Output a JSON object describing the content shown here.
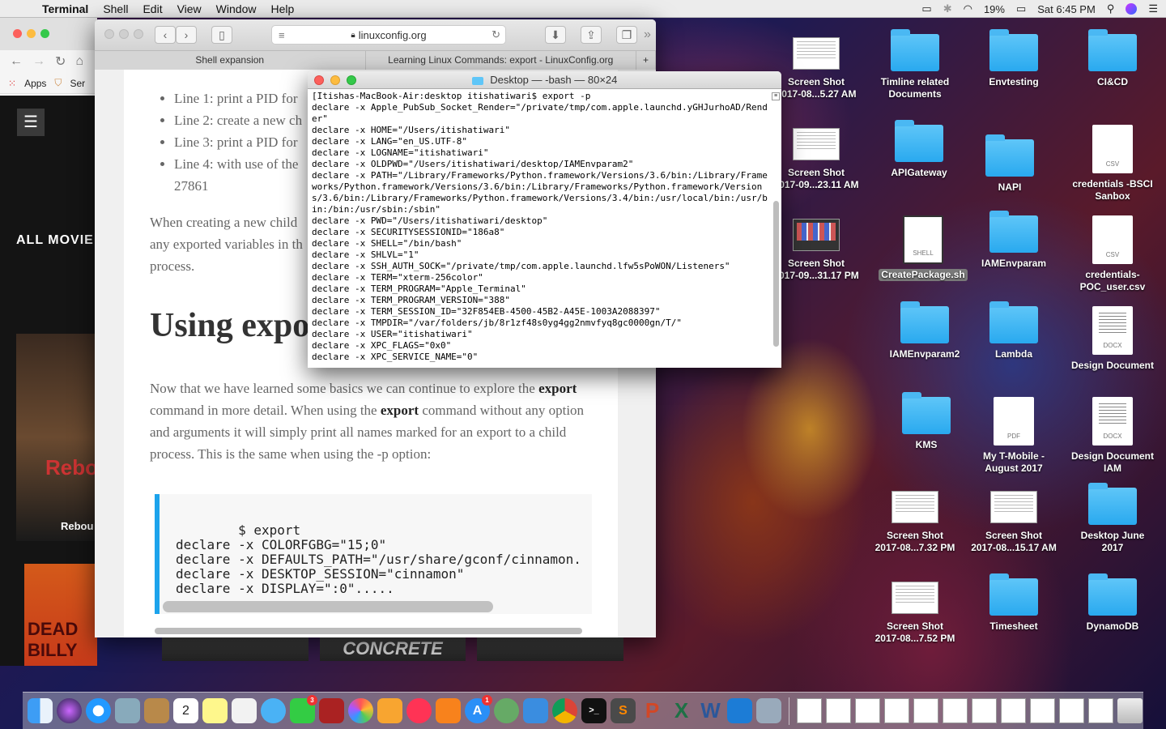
{
  "menubar": {
    "app_name": "Terminal",
    "items": [
      "Shell",
      "Edit",
      "View",
      "Window",
      "Help"
    ],
    "battery": "19%",
    "clock": "Sat 6:45 PM"
  },
  "chrome": {
    "bookmarks_apps": "Apps",
    "bookmarks_partial": "Ser",
    "all_movies": "ALL MOVIE",
    "poster1_title": "Reboo",
    "poster1_caption": "Rebou",
    "poster2_title": "DEAD BILLY",
    "posters_bottom_partial": "CONCRETE"
  },
  "safari": {
    "url": "linuxconfig.org",
    "tabs": [
      "Shell expansion",
      "Learning Linux Commands: export - LinuxConfig.org"
    ],
    "article": {
      "list": [
        "Line 1: print a PID for",
        "Line 2: create a new ch",
        "Line 3: print a PID for",
        "Line 4: with use of the"
      ],
      "list_tail": "27861",
      "para1": "When creating a new child\nany exported variables in th\nprocess.",
      "heading": "Using expo",
      "para2_a": "Now that we have learned some basics we can continue to explore the ",
      "para2_b": "export",
      "para2_c": " command in more detail. When using the ",
      "para2_d": "export",
      "para2_e": " command without any option and arguments it will simply print all names marked for an export to a child process. This is the same when using the -p option:",
      "code": "$ export\ndeclare -x COLORFGBG=\"15;0\"\ndeclare -x DEFAULTS_PATH=\"/usr/share/gconf/cinnamon.\ndeclare -x DESKTOP_SESSION=\"cinnamon\"\ndeclare -x DISPLAY=\":0\"....."
    }
  },
  "terminal": {
    "title": "Desktop — -bash — 80×24",
    "output": "[Itishas-MacBook-Air:desktop itishatiwari$ export -p\ndeclare -x Apple_PubSub_Socket_Render=\"/private/tmp/com.apple.launchd.yGHJurhoAD/Render\"\ndeclare -x HOME=\"/Users/itishatiwari\"\ndeclare -x LANG=\"en_US.UTF-8\"\ndeclare -x LOGNAME=\"itishatiwari\"\ndeclare -x OLDPWD=\"/Users/itishatiwari/desktop/IAMEnvparam2\"\ndeclare -x PATH=\"/Library/Frameworks/Python.framework/Versions/3.6/bin:/Library/Frameworks/Python.framework/Versions/3.6/bin:/Library/Frameworks/Python.framework/Versions/3.6/bin:/Library/Frameworks/Python.framework/Versions/3.4/bin:/usr/local/bin:/usr/bin:/bin:/usr/sbin:/sbin\"\ndeclare -x PWD=\"/Users/itishatiwari/desktop\"\ndeclare -x SECURITYSESSIONID=\"186a8\"\ndeclare -x SHELL=\"/bin/bash\"\ndeclare -x SHLVL=\"1\"\ndeclare -x SSH_AUTH_SOCK=\"/private/tmp/com.apple.launchd.lfw5sPoWON/Listeners\"\ndeclare -x TERM=\"xterm-256color\"\ndeclare -x TERM_PROGRAM=\"Apple_Terminal\"\ndeclare -x TERM_PROGRAM_VERSION=\"388\"\ndeclare -x TERM_SESSION_ID=\"32F854EB-4500-45B2-A45E-1003A2088397\"\ndeclare -x TMPDIR=\"/var/folders/jb/8r1zf48s0yg4gg2nmvfyq8gc0000gn/T/\"\ndeclare -x USER=\"itishatiwari\"\ndeclare -x XPC_FLAGS=\"0x0\"\ndeclare -x XPC_SERVICE_NAME=\"0\""
  },
  "desktop": {
    "items": [
      {
        "label": "Screen Shot\n2017-08...5.27 AM",
        "kind": "shot"
      },
      {
        "label": "Timline related\nDocuments",
        "kind": "folder"
      },
      {
        "label": "Envtesting",
        "kind": "folder"
      },
      {
        "label": "CI&CD",
        "kind": "folder"
      },
      {
        "label": "Screen Shot\n2017-09...23.11 AM",
        "kind": "shot"
      },
      {
        "label": "APIGateway",
        "kind": "folder"
      },
      {
        "label": "NAPI",
        "kind": "folder"
      },
      {
        "label": "credentials -BSCI\nSanbox",
        "kind": "csv",
        "type": "CSV"
      },
      {
        "label": "Screen Shot\n2017-09...31.17 PM",
        "kind": "shotdark"
      },
      {
        "label": "CreatePackage.sh",
        "kind": "shell",
        "type": "SHELL"
      },
      {
        "label": "IAMEnvparam",
        "kind": "folder"
      },
      {
        "label": "credentials-\nPOC_user.csv",
        "kind": "csv",
        "type": "CSV"
      },
      {
        "label": "IAMEnvparam2",
        "kind": "folder"
      },
      {
        "label": "Lambda",
        "kind": "folder"
      },
      {
        "label": "Design Document",
        "kind": "docx",
        "type": "DOCX"
      },
      {
        "label": "KMS",
        "kind": "folder"
      },
      {
        "label": "My T-Mobile -\nAugust 2017",
        "kind": "pdf",
        "type": "PDF"
      },
      {
        "label": "Design Document\nIAM",
        "kind": "docx",
        "type": "DOCX"
      },
      {
        "label": "Screen Shot\n2017-08...7.32 PM",
        "kind": "shot"
      },
      {
        "label": "Screen Shot\n2017-08...15.17 AM",
        "kind": "shot"
      },
      {
        "label": "Desktop June\n2017",
        "kind": "folder"
      },
      {
        "label": "Screen Shot\n2017-08...7.52 PM",
        "kind": "shot"
      },
      {
        "label": "Timesheet",
        "kind": "folder"
      },
      {
        "label": "DynamoDB",
        "kind": "folder"
      }
    ]
  },
  "dock": {
    "calendar_day": "2",
    "facetime_badge": "3",
    "appstore_badge": "1"
  },
  "colors": {
    "folder_blue": "#3db5f2",
    "close_red": "#fc605c",
    "minimize_yellow": "#fdbc40",
    "zoom_green": "#34c84a",
    "code_accent": "#1ca3ec"
  }
}
